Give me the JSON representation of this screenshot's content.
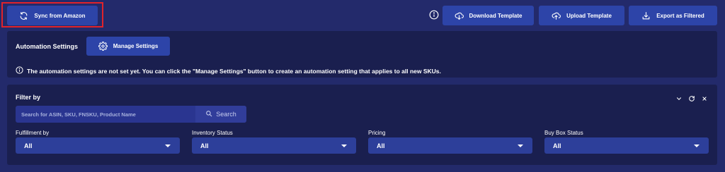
{
  "toolbar": {
    "sync_label": "Sync from Amazon",
    "download_label": "Download Template",
    "upload_label": "Upload Template",
    "export_label": "Export as Filtered"
  },
  "automation": {
    "title": "Automation Settings",
    "manage_label": "Manage Settings",
    "notice": "The automation settings are not set yet. You can click the \"Manage Settings\" button to create an automation setting that applies to all new SKUs."
  },
  "filter": {
    "title": "Filter by",
    "search_placeholder": "Search for ASIN, SKU, FNSKU, Product Name",
    "search_button": "Search",
    "fields": [
      {
        "label": "Fulfillment by",
        "value": "All"
      },
      {
        "label": "Inventory Status",
        "value": "All"
      },
      {
        "label": "Pricing",
        "value": "All"
      },
      {
        "label": "Buy Box Status",
        "value": "All"
      }
    ]
  },
  "colors": {
    "background": "#232a6b",
    "panel": "#1a1f4f",
    "button": "#2d44a8",
    "highlight": "#e0232b"
  }
}
